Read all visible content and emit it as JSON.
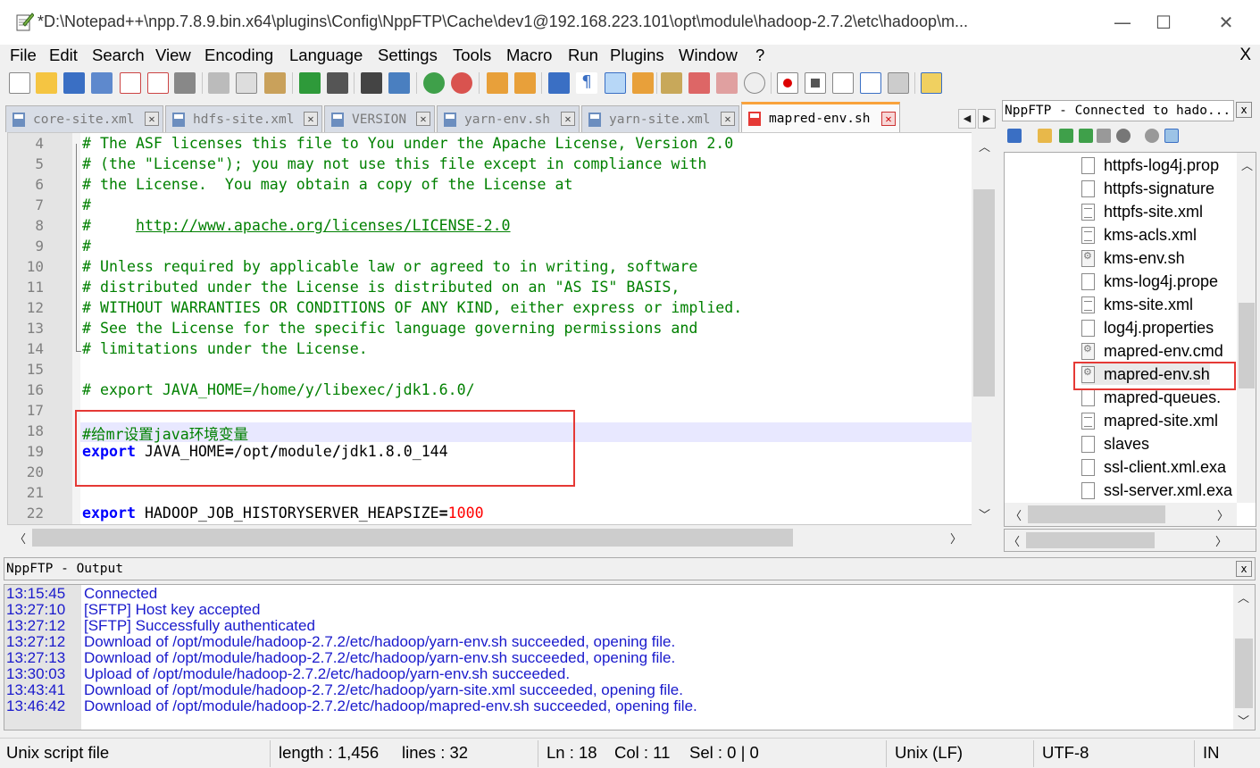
{
  "window": {
    "title": "*D:\\Notepad++\\npp.7.8.9.bin.x64\\plugins\\Config\\NppFTP\\Cache\\dev1@192.168.223.101\\opt\\module\\hadoop-2.7.2\\etc\\hadoop\\m...",
    "minimize": "—",
    "maximize": "☐",
    "close": "✕"
  },
  "menu": {
    "items": [
      "File",
      "Edit",
      "Search",
      "View",
      "Encoding",
      "Language",
      "Settings",
      "Tools",
      "Macro",
      "Run",
      "Plugins",
      "Window",
      "?"
    ],
    "close_doc": "X"
  },
  "tabs": [
    {
      "label": "core-site.xml",
      "active": false
    },
    {
      "label": "hdfs-site.xml",
      "active": false
    },
    {
      "label": "VERSION",
      "active": false
    },
    {
      "label": "yarn-env.sh",
      "active": false
    },
    {
      "label": "yarn-site.xml",
      "active": false
    },
    {
      "label": "mapred-env.sh",
      "active": true
    }
  ],
  "editor": {
    "lines": [
      {
        "n": "4",
        "text": "# The ASF licenses this file to You under the Apache License, Version 2.0"
      },
      {
        "n": "5",
        "text": "# (the \"License\"); you may not use this file except in compliance with"
      },
      {
        "n": "6",
        "text": "# the License.  You may obtain a copy of the License at"
      },
      {
        "n": "7",
        "text": "#"
      },
      {
        "n": "8",
        "text_prefix": "#     ",
        "url": "http://www.apache.org/licenses/LICENSE-2.0"
      },
      {
        "n": "9",
        "text": "#"
      },
      {
        "n": "10",
        "text": "# Unless required by applicable law or agreed to in writing, software"
      },
      {
        "n": "11",
        "text": "# distributed under the License is distributed on an \"AS IS\" BASIS,"
      },
      {
        "n": "12",
        "text": "# WITHOUT WARRANTIES OR CONDITIONS OF ANY KIND, either express or implied."
      },
      {
        "n": "13",
        "text": "# See the License for the specific language governing permissions and"
      },
      {
        "n": "14",
        "text": "# limitations under the License."
      },
      {
        "n": "15",
        "text": ""
      },
      {
        "n": "16",
        "text": "# export JAVA_HOME=/home/y/libexec/jdk1.6.0/"
      },
      {
        "n": "17",
        "text": ""
      },
      {
        "n": "18",
        "text": "#给mr设置java环境变量"
      },
      {
        "n": "19",
        "kw": "export",
        "var": " JAVA_HOME",
        "eq": "=",
        "val1": "/opt",
        "s1": "/",
        "val2": "module",
        "s2": "/",
        "val3": "jdk1.8.0_144"
      },
      {
        "n": "20",
        "text": ""
      },
      {
        "n": "21",
        "text": ""
      },
      {
        "n": "22",
        "kw": "export",
        "var": " HADOOP_JOB_HISTORYSERVER_HEAPSIZE",
        "eq": "=",
        "num": "1000"
      }
    ]
  },
  "ftp": {
    "header": "NppFTP - Connected to hado...",
    "close": "x",
    "files": [
      {
        "name": "httpfs-log4j.prop",
        "icon": "doc"
      },
      {
        "name": "httpfs-signature",
        "icon": "doc"
      },
      {
        "name": "httpfs-site.xml",
        "icon": "lines"
      },
      {
        "name": "kms-acls.xml",
        "icon": "lines"
      },
      {
        "name": "kms-env.sh",
        "icon": "gear"
      },
      {
        "name": "kms-log4j.prope",
        "icon": "doc"
      },
      {
        "name": "kms-site.xml",
        "icon": "lines"
      },
      {
        "name": "log4j.properties",
        "icon": "doc"
      },
      {
        "name": "mapred-env.cmd",
        "icon": "gear"
      },
      {
        "name": "mapred-env.sh",
        "icon": "gear",
        "selected": true
      },
      {
        "name": "mapred-queues.",
        "icon": "doc"
      },
      {
        "name": "mapred-site.xml",
        "icon": "lines"
      },
      {
        "name": "slaves",
        "icon": "doc"
      },
      {
        "name": "ssl-client.xml.exa",
        "icon": "doc"
      },
      {
        "name": "ssl-server.xml.exa",
        "icon": "doc"
      }
    ]
  },
  "output": {
    "header": "NppFTP - Output",
    "close": "x",
    "lines": [
      {
        "time": "13:15:45",
        "msg": "Connected"
      },
      {
        "time": "13:27:10",
        "msg": "[SFTP] Host key accepted"
      },
      {
        "time": "13:27:12",
        "msg": "[SFTP] Successfully authenticated"
      },
      {
        "time": "13:27:12",
        "msg": "Download of /opt/module/hadoop-2.7.2/etc/hadoop/yarn-env.sh succeeded, opening file."
      },
      {
        "time": "13:27:13",
        "msg": "Download of /opt/module/hadoop-2.7.2/etc/hadoop/yarn-env.sh succeeded, opening file."
      },
      {
        "time": "13:30:03",
        "msg": "Upload of /opt/module/hadoop-2.7.2/etc/hadoop/yarn-env.sh succeeded."
      },
      {
        "time": "13:43:41",
        "msg": "Download of /opt/module/hadoop-2.7.2/etc/hadoop/yarn-site.xml succeeded, opening file."
      },
      {
        "time": "13:46:42",
        "msg": "Download of /opt/module/hadoop-2.7.2/etc/hadoop/mapred-env.sh succeeded, opening file."
      }
    ]
  },
  "status": {
    "filetype": "Unix script file",
    "length": "length : 1,456",
    "lines": "lines : 32",
    "ln": "Ln : 18",
    "col": "Col : 11",
    "sel": "Sel : 0 | 0",
    "eol": "Unix (LF)",
    "encoding": "UTF-8",
    "mode": "IN"
  },
  "colors": {
    "comment": "#008000",
    "keyword": "#0000ff",
    "number": "#ff0000",
    "output_text": "#1a1acc",
    "highlight_box": "#e53935",
    "active_tab_accent": "#f9a23b"
  },
  "icons": {
    "app": "notepad-plus-icon",
    "toolbar": [
      "new-file-icon",
      "open-file-icon",
      "save-icon",
      "save-all-icon",
      "close-icon",
      "close-all-icon",
      "print-icon",
      "cut-icon",
      "copy-icon",
      "paste-icon",
      "undo-icon",
      "redo-icon",
      "find-icon",
      "replace-icon",
      "zoom-in-icon",
      "zoom-out-icon",
      "sync-vertical-icon",
      "sync-horizontal-icon",
      "word-wrap-icon",
      "show-all-chars-icon",
      "indent-guide-icon",
      "doc-map-icon",
      "function-list-icon",
      "folder-workspace-icon",
      "monitoring-icon",
      "record-macro-icon",
      "stop-macro-icon",
      "play-macro-icon",
      "run-macro-multiple-icon",
      "save-macro-icon",
      "ftp-plugin-icon"
    ]
  }
}
